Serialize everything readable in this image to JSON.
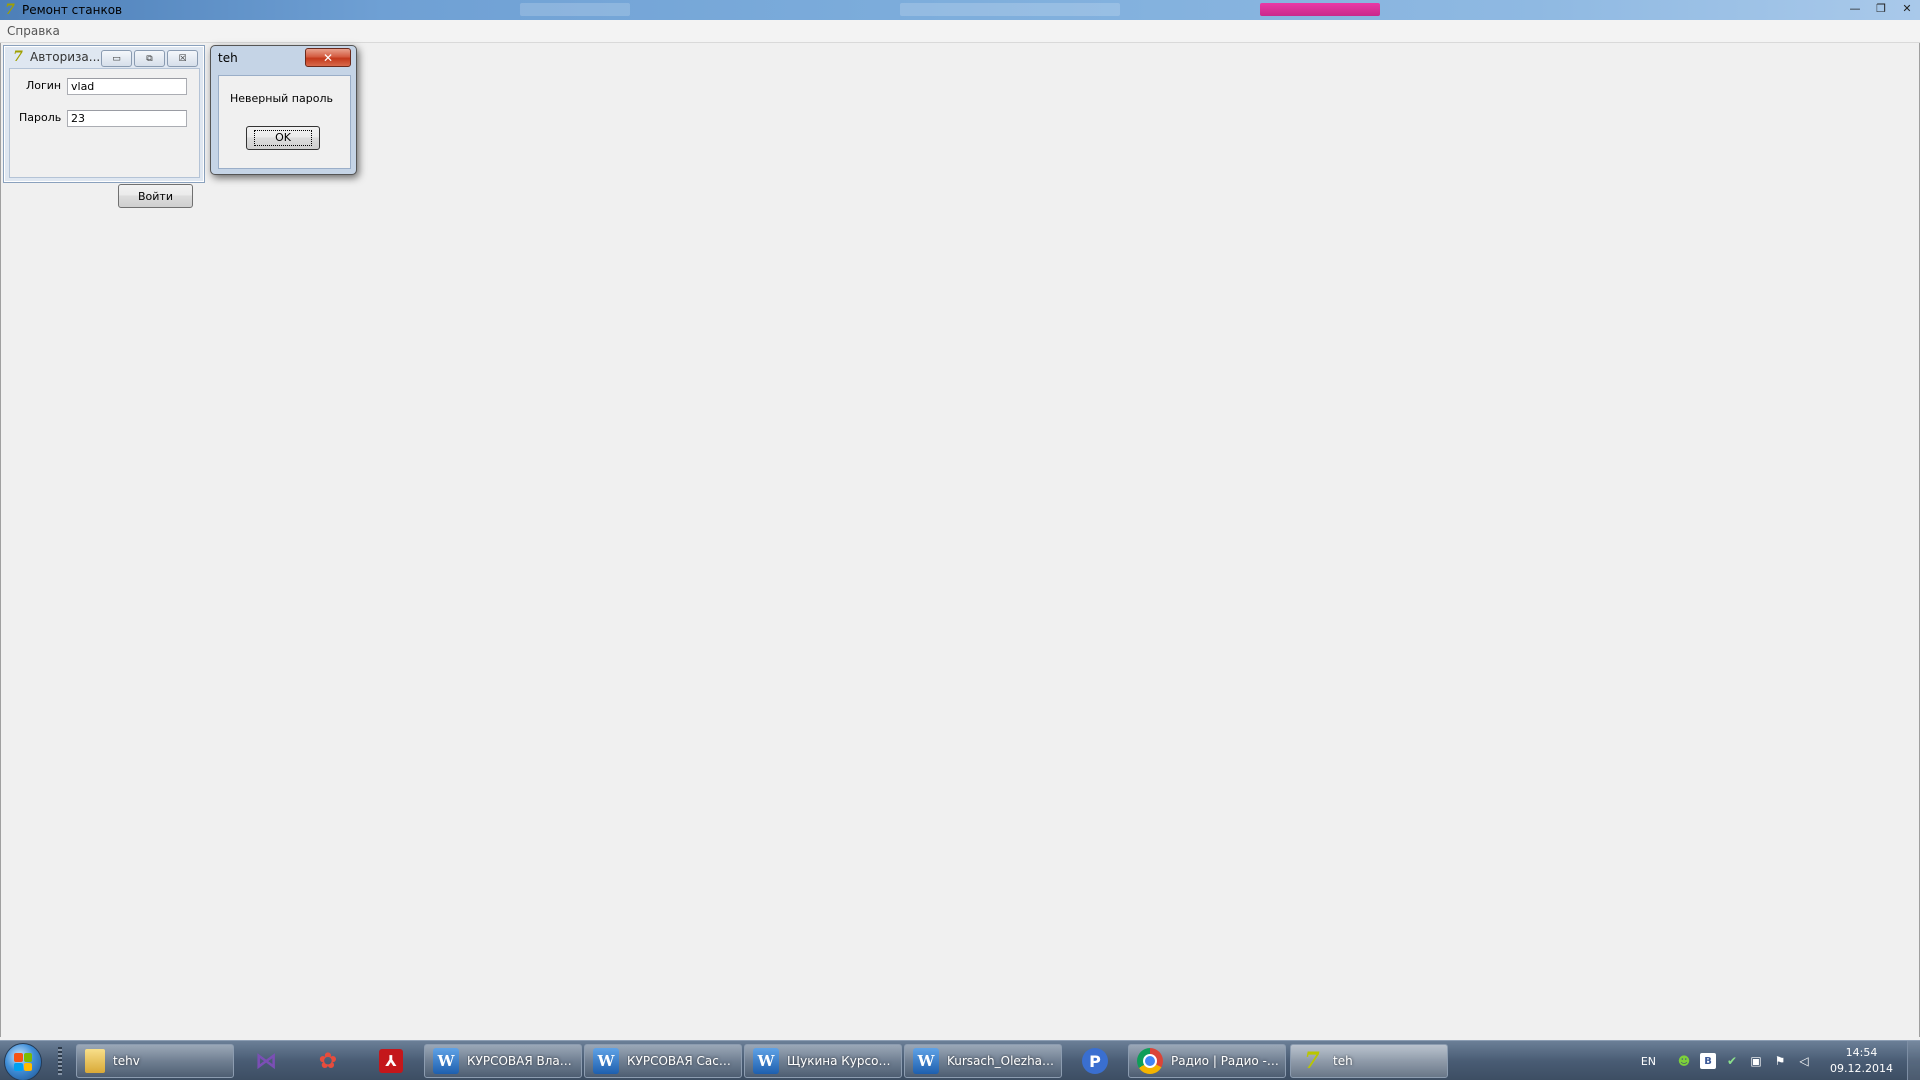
{
  "window": {
    "title": "Ремонт станков",
    "controls": {
      "minimize": "—",
      "maximize": "❐",
      "close": "✕"
    }
  },
  "menu": {
    "items": [
      "Справка"
    ]
  },
  "auth_form": {
    "title": "Авториза...",
    "login_label": "Логин",
    "login_value": "vlad",
    "password_label": "Пароль",
    "password_value": "23",
    "submit_label": "Войти",
    "controls": {
      "minimize": "▭",
      "restore": "⧉",
      "close": "☒"
    }
  },
  "message_box": {
    "title": "teh",
    "text": "Неверный пароль",
    "ok_label": "OK",
    "close": "✕"
  },
  "taskbar": {
    "items": [
      {
        "label": "tehv",
        "icon": "folder-icon"
      },
      {
        "label": "",
        "icon": "visual-studio-icon"
      },
      {
        "label": "",
        "icon": "paint-icon"
      },
      {
        "label": "",
        "icon": "acrobat-icon"
      },
      {
        "label": "КУРСОВАЯ Влада...",
        "icon": "word-icon"
      },
      {
        "label": "КУРСОВАЯ Сасо...",
        "icon": "word-icon"
      },
      {
        "label": "Щукина Курсова...",
        "icon": "word-icon"
      },
      {
        "label": "Kursach_Olezha - ...",
        "icon": "word-icon"
      },
      {
        "label": "",
        "icon": "radiot-icon"
      },
      {
        "label": "Радио | Радио - N...",
        "icon": "chrome-icon"
      },
      {
        "label": "teh",
        "icon": "app-icon"
      }
    ],
    "tray": {
      "language": "EN",
      "time": "14:54",
      "date": "09.12.2014"
    }
  }
}
